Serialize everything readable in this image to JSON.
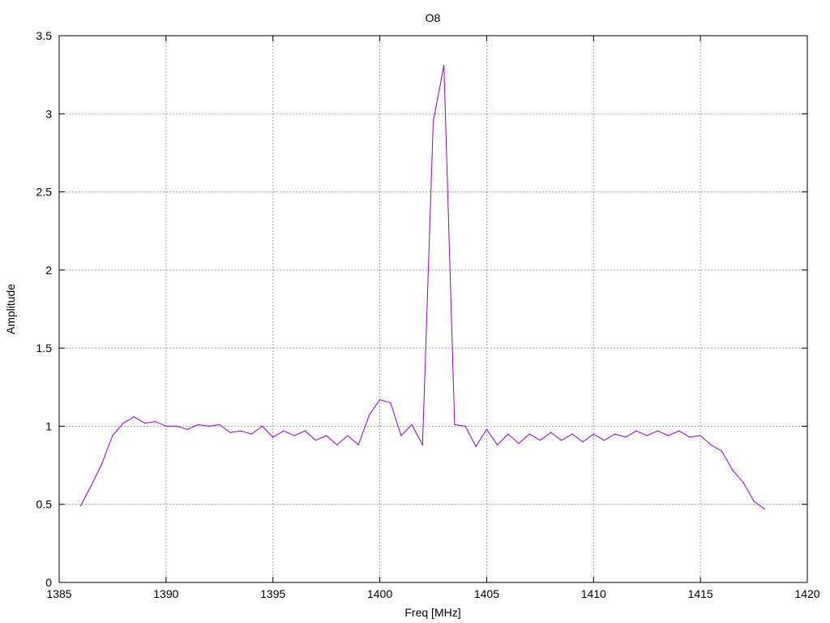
{
  "chart_data": {
    "type": "line",
    "title": "O8",
    "xlabel": "Freq [MHz]",
    "ylabel": "Amplitude",
    "xlim": [
      1385,
      1420
    ],
    "ylim": [
      0,
      3.5
    ],
    "xticks": [
      1385,
      1390,
      1395,
      1400,
      1405,
      1410,
      1415,
      1420
    ],
    "yticks": [
      0,
      0.5,
      1,
      1.5,
      2,
      2.5,
      3,
      3.5
    ],
    "xtick_labels": [
      "1385",
      "1390",
      "1395",
      "1400",
      "1405",
      "1410",
      "1415",
      "1420"
    ],
    "ytick_labels": [
      "0",
      "0.5",
      "1",
      "1.5",
      "2",
      "2.5",
      "3",
      "3.5"
    ],
    "grid": true,
    "series": [
      {
        "color": "#9400d3",
        "x": [
          1386.0,
          1386.5,
          1387.0,
          1387.5,
          1388.0,
          1388.5,
          1389.0,
          1389.5,
          1390.0,
          1390.5,
          1391.0,
          1391.5,
          1392.0,
          1392.5,
          1393.0,
          1393.5,
          1394.0,
          1394.5,
          1395.0,
          1395.5,
          1396.0,
          1396.5,
          1397.0,
          1397.5,
          1398.0,
          1398.5,
          1399.0,
          1399.5,
          1400.0,
          1400.5,
          1401.0,
          1401.5,
          1402.0,
          1402.5,
          1403.0,
          1403.5,
          1404.0,
          1404.5,
          1405.0,
          1405.5,
          1406.0,
          1406.5,
          1407.0,
          1407.5,
          1408.0,
          1408.5,
          1409.0,
          1409.5,
          1410.0,
          1410.5,
          1411.0,
          1411.5,
          1412.0,
          1412.5,
          1413.0,
          1413.5,
          1414.0,
          1414.5,
          1415.0,
          1415.5,
          1416.0,
          1416.5,
          1417.0,
          1417.5,
          1418.0
        ],
        "y": [
          0.49,
          0.62,
          0.76,
          0.94,
          1.02,
          1.06,
          1.02,
          1.03,
          1.0,
          1.0,
          0.98,
          1.01,
          1.0,
          1.01,
          0.96,
          0.97,
          0.95,
          1.0,
          0.93,
          0.97,
          0.94,
          0.97,
          0.91,
          0.94,
          0.88,
          0.94,
          0.88,
          1.07,
          1.17,
          1.15,
          0.94,
          1.01,
          0.88,
          2.95,
          3.31,
          1.01,
          1.0,
          0.87,
          0.98,
          0.88,
          0.95,
          0.89,
          0.95,
          0.91,
          0.96,
          0.91,
          0.95,
          0.9,
          0.95,
          0.91,
          0.95,
          0.93,
          0.97,
          0.94,
          0.97,
          0.94,
          0.97,
          0.93,
          0.94,
          0.88,
          0.84,
          0.72,
          0.64,
          0.52,
          0.47
        ]
      }
    ]
  }
}
